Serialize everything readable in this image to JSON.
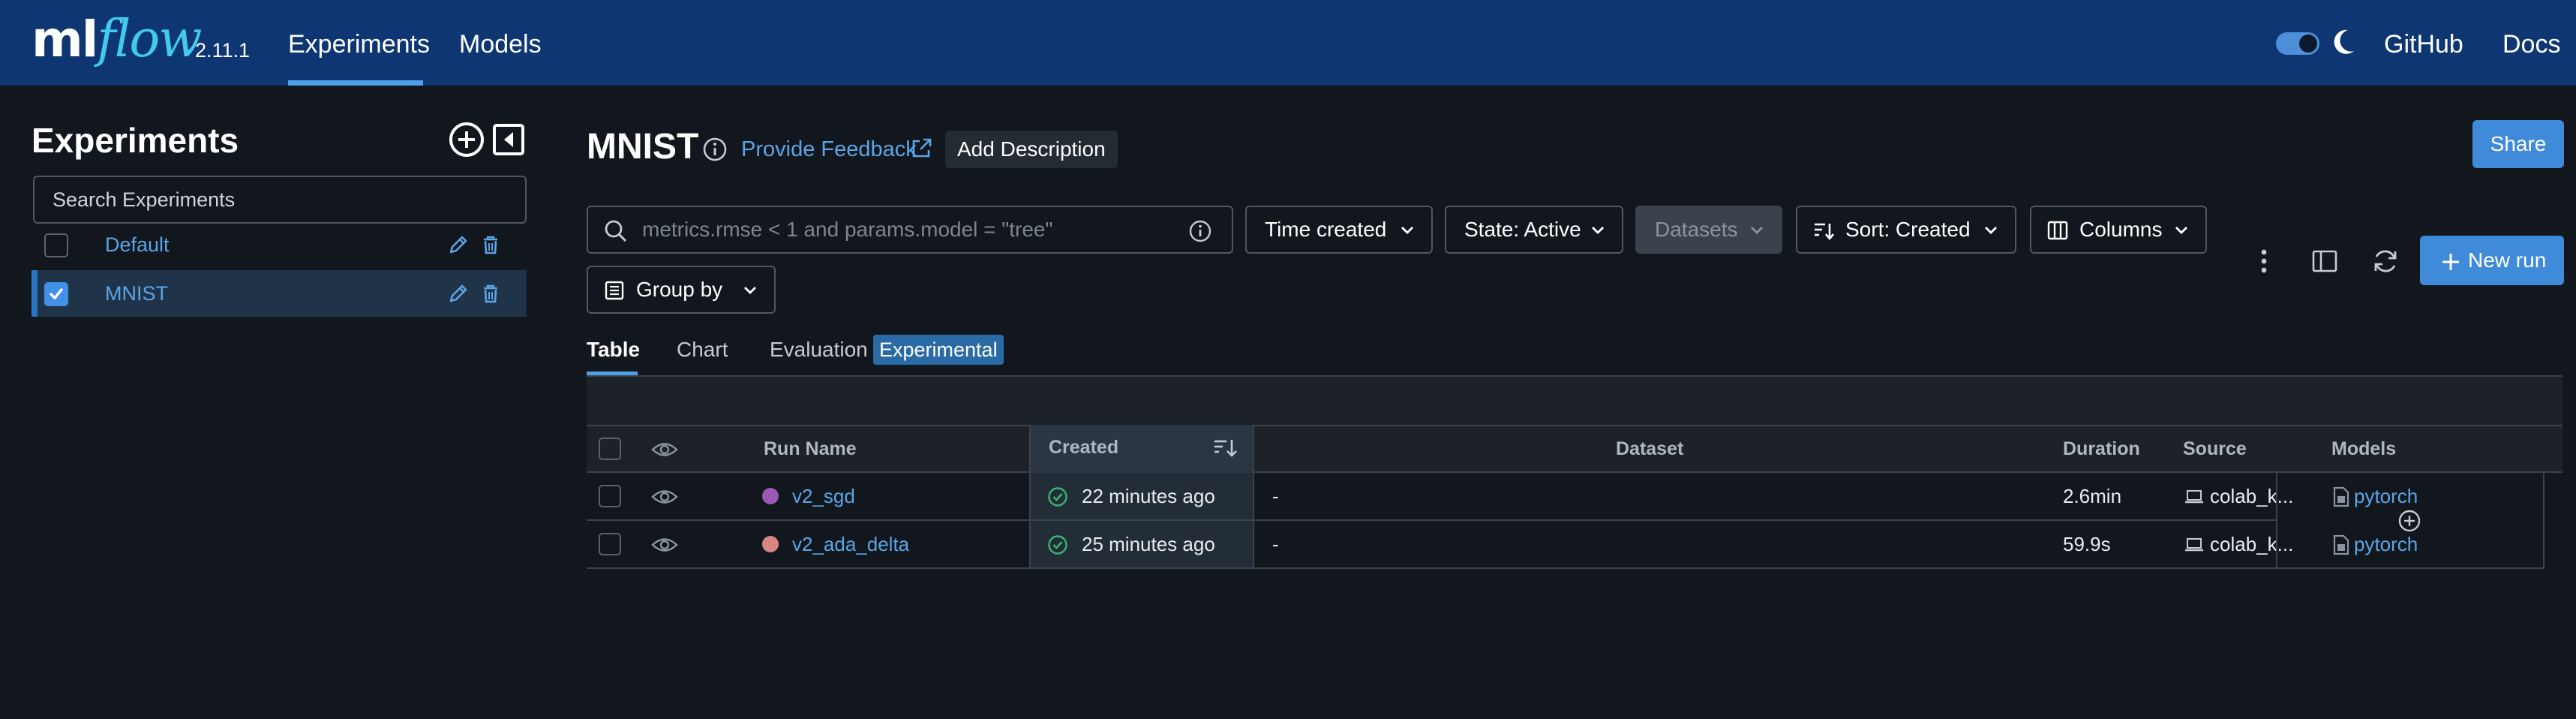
{
  "header": {
    "logo_ml": "ml",
    "logo_flow": "flow",
    "version": "2.11.1",
    "nav": [
      "Experiments",
      "Models"
    ],
    "github": "GitHub",
    "docs": "Docs"
  },
  "sidebar": {
    "title": "Experiments",
    "search_placeholder": "Search Experiments",
    "items": [
      {
        "label": "Default",
        "checked": false
      },
      {
        "label": "MNIST",
        "checked": true
      }
    ]
  },
  "main": {
    "title": "MNIST",
    "feedback": "Provide Feedback",
    "add_description": "Add Description",
    "share": "Share",
    "filter_placeholder": "metrics.rmse < 1 and params.model = \"tree\"",
    "time_created": "Time created",
    "state": "State: Active",
    "datasets": "Datasets",
    "sort": "Sort: Created",
    "columns": "Columns",
    "new_run": "New run",
    "group_by": "Group by",
    "tabs": [
      "Table",
      "Chart",
      "Evaluation"
    ],
    "experimental_badge": "Experimental"
  },
  "table": {
    "headers": {
      "run_name": "Run Name",
      "created": "Created",
      "dataset": "Dataset",
      "duration": "Duration",
      "source": "Source",
      "models": "Models"
    },
    "rows": [
      {
        "name": "v2_sgd",
        "dot_color": "#9b59b6",
        "created": "22 minutes ago",
        "dataset": "-",
        "duration": "2.6min",
        "source": "colab_k...",
        "model": "pytorch"
      },
      {
        "name": "v2_ada_delta",
        "dot_color": "#d98586",
        "created": "25 minutes ago",
        "dataset": "-",
        "duration": "59.9s",
        "source": "colab_k...",
        "model": "pytorch"
      }
    ]
  },
  "colors": {
    "header_bg": "#0e3673",
    "accent": "#3f8ad9",
    "link": "#5ca4e8",
    "page_bg": "#11171c"
  }
}
